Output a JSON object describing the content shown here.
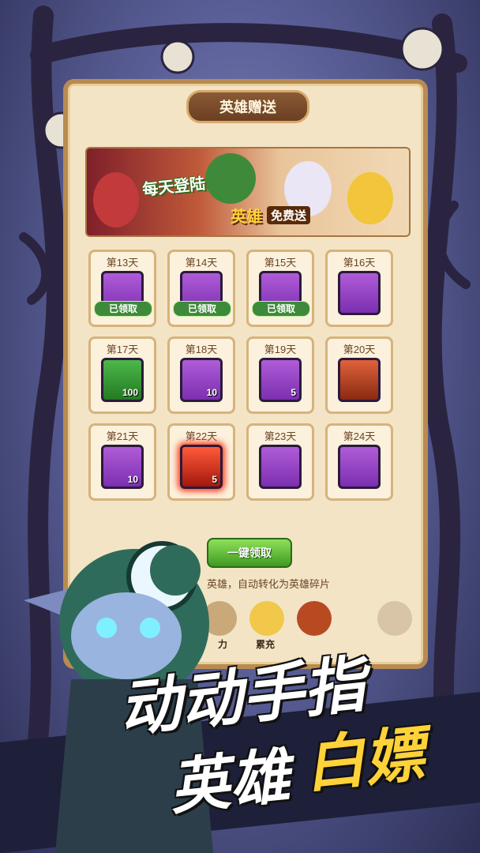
{
  "panel": {
    "title": "英雄赠送"
  },
  "banner": {
    "line1": "每天登陆",
    "line2": "英雄",
    "line3": "免费送"
  },
  "days": [
    {
      "label": "第13天",
      "item": "sword-card",
      "status": "已领取"
    },
    {
      "label": "第14天",
      "item": "sword-card",
      "status": "已领取"
    },
    {
      "label": "第15天",
      "item": "sword-card",
      "status": "已领取"
    },
    {
      "label": "第16天",
      "item": "hero-portrait",
      "status": ""
    },
    {
      "label": "第17天",
      "item": "green-orb",
      "qty": "100"
    },
    {
      "label": "第18天",
      "item": "sword-card",
      "qty": "10"
    },
    {
      "label": "第19天",
      "item": "gem-badge",
      "qty": "5"
    },
    {
      "label": "第20天",
      "item": "hero-portrait",
      "qty": ""
    },
    {
      "label": "第21天",
      "item": "sword-card",
      "qty": "10"
    },
    {
      "label": "第22天",
      "item": "emerald",
      "qty": "5"
    },
    {
      "label": "第23天",
      "item": "sword-card",
      "qty": ""
    },
    {
      "label": "第24天",
      "item": "hero-portrait",
      "qty": ""
    }
  ],
  "claim_button": "一键领取",
  "note": "英雄，自动转化为英雄碎片",
  "bottom_labels": [
    "力",
    "累充"
  ],
  "slogan": {
    "line1": "动动手指",
    "line2": "英雄",
    "line3": "白嫖"
  }
}
